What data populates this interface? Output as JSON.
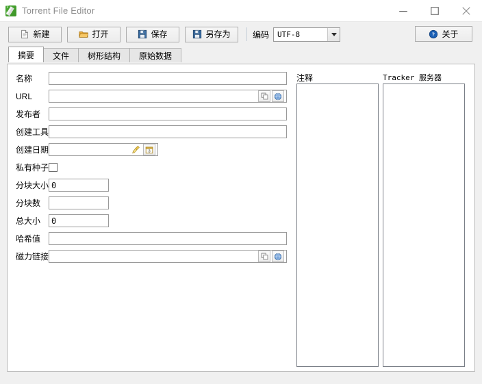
{
  "window": {
    "title": "Torrent File Editor",
    "app_icon": "torrent-file-editor-icon",
    "icon_letter_top": "T",
    "icon_letter_bottom": "E",
    "minimize_label": "—",
    "maximize_label": "□",
    "close_label": "✕"
  },
  "toolbar": {
    "buttons": [
      {
        "label": "新建",
        "icon": "new-document-icon"
      },
      {
        "label": "打开",
        "icon": "open-folder-icon"
      },
      {
        "label": "保存",
        "icon": "floppy-save-icon"
      },
      {
        "label": "另存为",
        "icon": "floppy-save-as-icon"
      }
    ],
    "encoding_label": "编码",
    "encoding_value": "UTF-8",
    "encoding_options": [
      "UTF-8"
    ],
    "about_label": "关于",
    "about_icon": "help-question-icon"
  },
  "tabs": [
    {
      "label": "摘要",
      "active": true
    },
    {
      "label": "文件",
      "active": false
    },
    {
      "label": "树形结构",
      "active": false
    },
    {
      "label": "原始数据",
      "active": false
    }
  ],
  "form": {
    "fields": [
      {
        "label": "名称",
        "value": ""
      },
      {
        "label": "URL",
        "value": ""
      },
      {
        "label": "发布者",
        "value": ""
      },
      {
        "label": "创建工具",
        "value": ""
      },
      {
        "label": "创建日期",
        "value": ""
      },
      {
        "label": "私有种子",
        "value": ""
      },
      {
        "label": "分块大小",
        "value": "0"
      },
      {
        "label": "分块数",
        "value": ""
      },
      {
        "label": "总大小",
        "value": "0"
      },
      {
        "label": "哈希值",
        "value": ""
      },
      {
        "label": "磁力链接",
        "value": ""
      }
    ],
    "private_checked": false,
    "url_copy_icon": "copy-icon",
    "url_open_icon": "globe-open-icon",
    "date_clear_icon": "broom-clear-icon",
    "date_pick_icon": "calendar-icon",
    "magnet_copy_icon": "copy-icon",
    "magnet_open_icon": "globe-open-icon"
  },
  "right": {
    "comment_label": "注释",
    "comment_value": "",
    "tracker_label": "Tracker 服务器",
    "tracker_value": ""
  },
  "colors": {
    "window_bg": "#f0f0f0",
    "panel_bg": "#ffffff",
    "title_text": "#8c8c8c",
    "border": "#9a9a9a",
    "accent_green": "#4aa832",
    "accent_blue": "#1a5fb4"
  }
}
